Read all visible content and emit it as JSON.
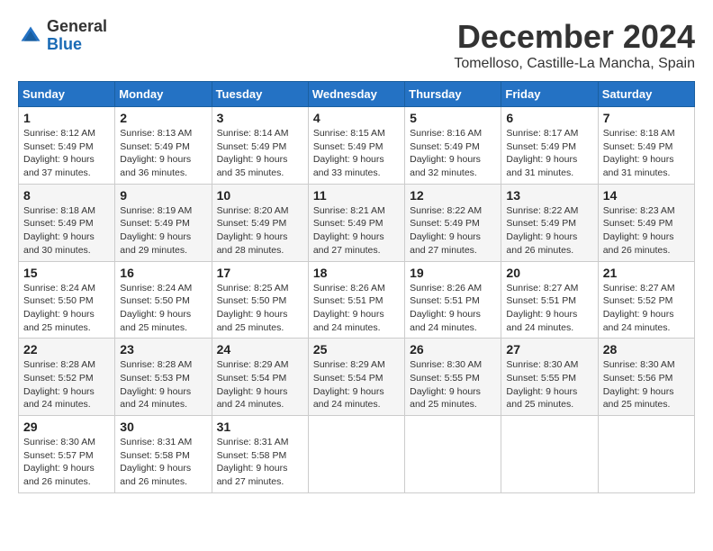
{
  "logo": {
    "line1": "General",
    "line2": "Blue"
  },
  "title": "December 2024",
  "subtitle": "Tomelloso, Castille-La Mancha, Spain",
  "days_of_week": [
    "Sunday",
    "Monday",
    "Tuesday",
    "Wednesday",
    "Thursday",
    "Friday",
    "Saturday"
  ],
  "weeks": [
    [
      {
        "day": "1",
        "sunrise": "8:12 AM",
        "sunset": "5:49 PM",
        "daylight": "9 hours and 37 minutes."
      },
      {
        "day": "2",
        "sunrise": "8:13 AM",
        "sunset": "5:49 PM",
        "daylight": "9 hours and 36 minutes."
      },
      {
        "day": "3",
        "sunrise": "8:14 AM",
        "sunset": "5:49 PM",
        "daylight": "9 hours and 35 minutes."
      },
      {
        "day": "4",
        "sunrise": "8:15 AM",
        "sunset": "5:49 PM",
        "daylight": "9 hours and 33 minutes."
      },
      {
        "day": "5",
        "sunrise": "8:16 AM",
        "sunset": "5:49 PM",
        "daylight": "9 hours and 32 minutes."
      },
      {
        "day": "6",
        "sunrise": "8:17 AM",
        "sunset": "5:49 PM",
        "daylight": "9 hours and 31 minutes."
      },
      {
        "day": "7",
        "sunrise": "8:18 AM",
        "sunset": "5:49 PM",
        "daylight": "9 hours and 31 minutes."
      }
    ],
    [
      {
        "day": "8",
        "sunrise": "8:18 AM",
        "sunset": "5:49 PM",
        "daylight": "9 hours and 30 minutes."
      },
      {
        "day": "9",
        "sunrise": "8:19 AM",
        "sunset": "5:49 PM",
        "daylight": "9 hours and 29 minutes."
      },
      {
        "day": "10",
        "sunrise": "8:20 AM",
        "sunset": "5:49 PM",
        "daylight": "9 hours and 28 minutes."
      },
      {
        "day": "11",
        "sunrise": "8:21 AM",
        "sunset": "5:49 PM",
        "daylight": "9 hours and 27 minutes."
      },
      {
        "day": "12",
        "sunrise": "8:22 AM",
        "sunset": "5:49 PM",
        "daylight": "9 hours and 27 minutes."
      },
      {
        "day": "13",
        "sunrise": "8:22 AM",
        "sunset": "5:49 PM",
        "daylight": "9 hours and 26 minutes."
      },
      {
        "day": "14",
        "sunrise": "8:23 AM",
        "sunset": "5:49 PM",
        "daylight": "9 hours and 26 minutes."
      }
    ],
    [
      {
        "day": "15",
        "sunrise": "8:24 AM",
        "sunset": "5:50 PM",
        "daylight": "9 hours and 25 minutes."
      },
      {
        "day": "16",
        "sunrise": "8:24 AM",
        "sunset": "5:50 PM",
        "daylight": "9 hours and 25 minutes."
      },
      {
        "day": "17",
        "sunrise": "8:25 AM",
        "sunset": "5:50 PM",
        "daylight": "9 hours and 25 minutes."
      },
      {
        "day": "18",
        "sunrise": "8:26 AM",
        "sunset": "5:51 PM",
        "daylight": "9 hours and 24 minutes."
      },
      {
        "day": "19",
        "sunrise": "8:26 AM",
        "sunset": "5:51 PM",
        "daylight": "9 hours and 24 minutes."
      },
      {
        "day": "20",
        "sunrise": "8:27 AM",
        "sunset": "5:51 PM",
        "daylight": "9 hours and 24 minutes."
      },
      {
        "day": "21",
        "sunrise": "8:27 AM",
        "sunset": "5:52 PM",
        "daylight": "9 hours and 24 minutes."
      }
    ],
    [
      {
        "day": "22",
        "sunrise": "8:28 AM",
        "sunset": "5:52 PM",
        "daylight": "9 hours and 24 minutes."
      },
      {
        "day": "23",
        "sunrise": "8:28 AM",
        "sunset": "5:53 PM",
        "daylight": "9 hours and 24 minutes."
      },
      {
        "day": "24",
        "sunrise": "8:29 AM",
        "sunset": "5:54 PM",
        "daylight": "9 hours and 24 minutes."
      },
      {
        "day": "25",
        "sunrise": "8:29 AM",
        "sunset": "5:54 PM",
        "daylight": "9 hours and 24 minutes."
      },
      {
        "day": "26",
        "sunrise": "8:30 AM",
        "sunset": "5:55 PM",
        "daylight": "9 hours and 25 minutes."
      },
      {
        "day": "27",
        "sunrise": "8:30 AM",
        "sunset": "5:55 PM",
        "daylight": "9 hours and 25 minutes."
      },
      {
        "day": "28",
        "sunrise": "8:30 AM",
        "sunset": "5:56 PM",
        "daylight": "9 hours and 25 minutes."
      }
    ],
    [
      {
        "day": "29",
        "sunrise": "8:30 AM",
        "sunset": "5:57 PM",
        "daylight": "9 hours and 26 minutes."
      },
      {
        "day": "30",
        "sunrise": "8:31 AM",
        "sunset": "5:58 PM",
        "daylight": "9 hours and 26 minutes."
      },
      {
        "day": "31",
        "sunrise": "8:31 AM",
        "sunset": "5:58 PM",
        "daylight": "9 hours and 27 minutes."
      },
      null,
      null,
      null,
      null
    ]
  ]
}
